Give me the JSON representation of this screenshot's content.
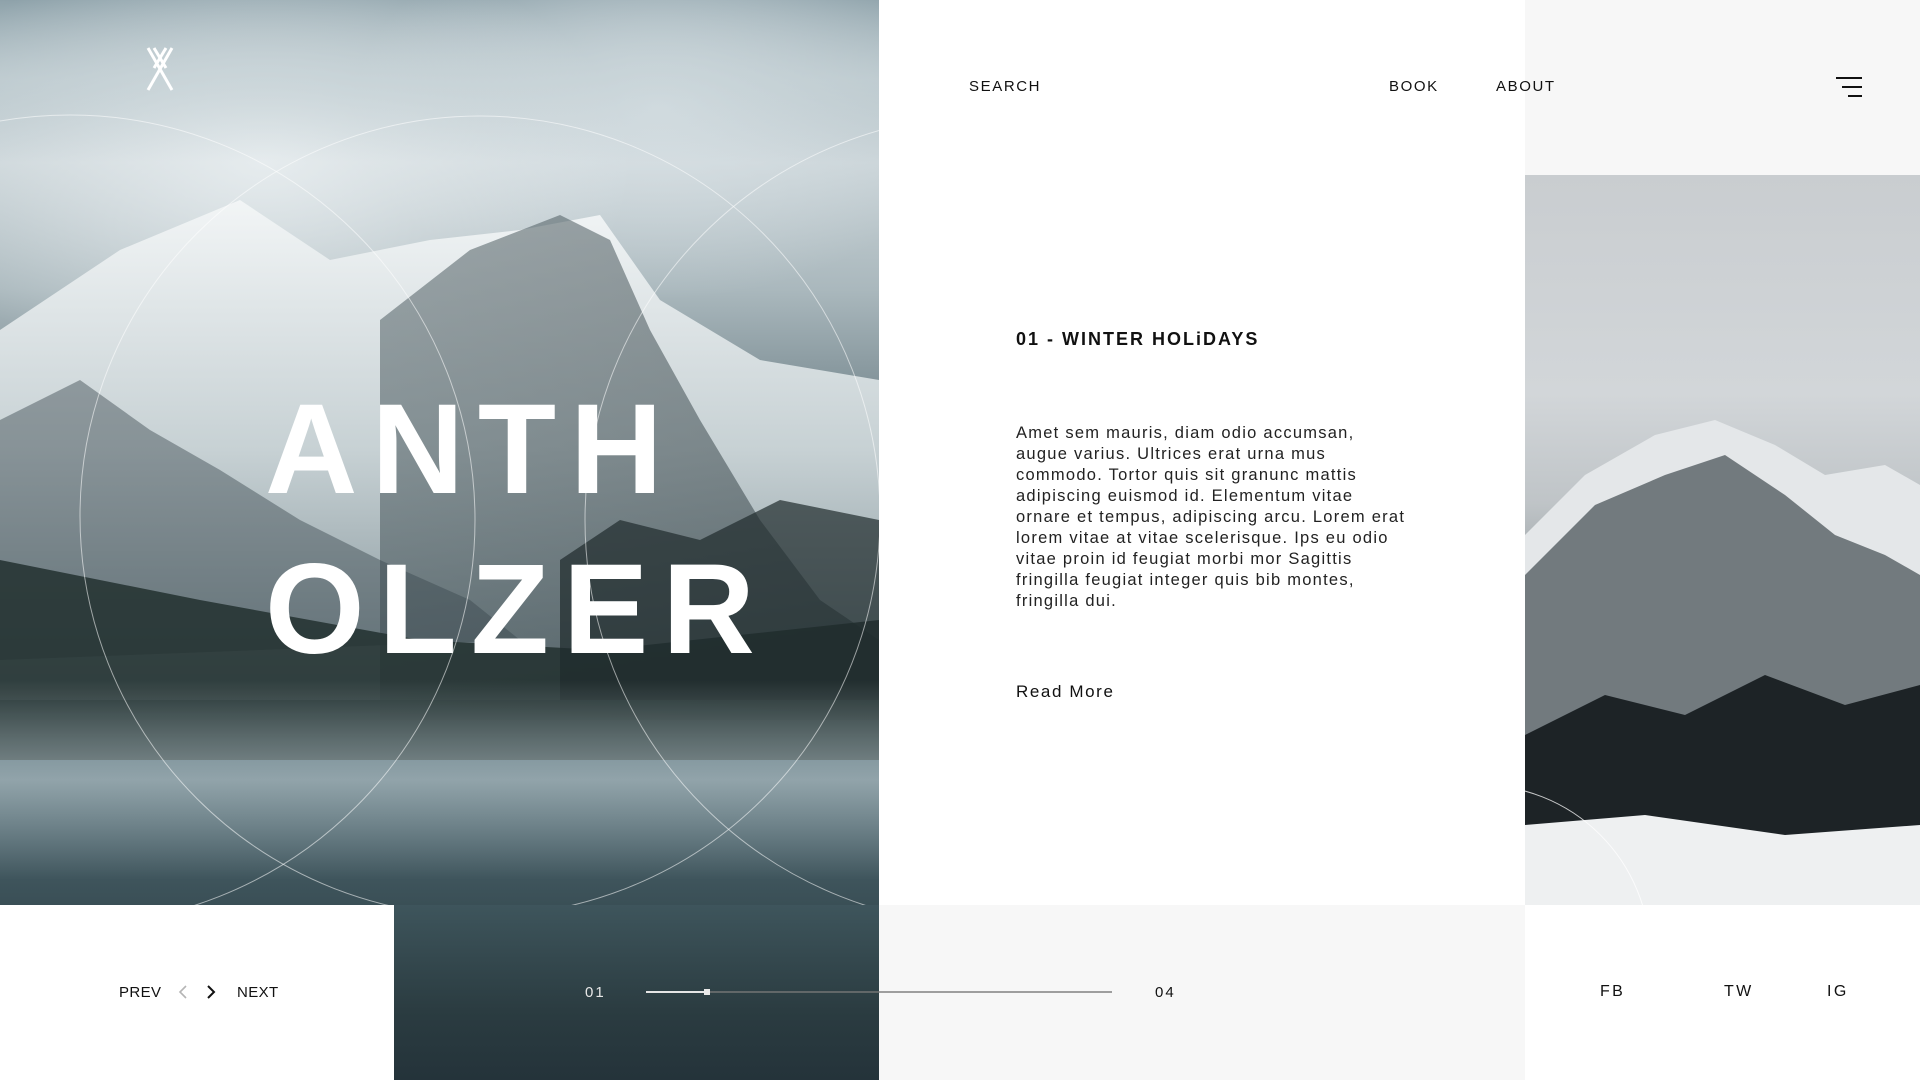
{
  "brand": {
    "logo_icon": "double-x-monogram-icon"
  },
  "header": {
    "nav": [
      {
        "label": "SEARCH"
      },
      {
        "label": "BOOK"
      },
      {
        "label": "ABOUT"
      }
    ],
    "menu_icon": "hamburger-menu-icon"
  },
  "hero": {
    "title_line1": "ANTH",
    "title_line2": "OLZER"
  },
  "content": {
    "title": "01 - WINTER HOLiDAYS",
    "body": "Amet sem mauris, diam odio accumsan, augue varius. Ultrices erat urna mus commodo. Tortor quis sit granunc mattis adipiscing euismod id. Elementum vitae ornare et tempus, adipiscing arcu. Lorem erat lorem vitae at vitae scelerisque. Ips eu odio vitae proin id feugiat morbi mor Sagittis fringilla feugiat integer quis bib montes, fringilla dui.",
    "read_more": "Read More"
  },
  "pager": {
    "prev_label": "PREV",
    "next_label": "NEXT",
    "prev_icon": "chevron-left-icon",
    "next_icon": "chevron-right-icon",
    "current": "01",
    "total": "04",
    "progress_fraction": 0.13
  },
  "social": [
    {
      "label": "FB"
    },
    {
      "label": "TW"
    },
    {
      "label": "IG"
    }
  ],
  "colors": {
    "text": "#111111",
    "panel_light": "#f7f7f7",
    "hero_dark": "#2e3d42"
  }
}
